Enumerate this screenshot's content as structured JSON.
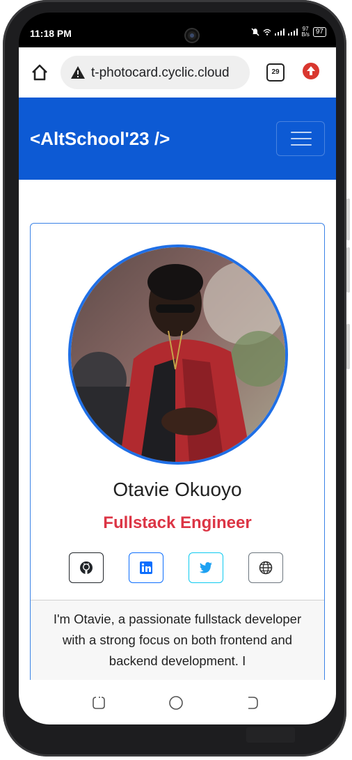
{
  "status": {
    "time": "11:18 PM",
    "net_speed_top": "97",
    "net_speed_bottom": "B/s",
    "battery": "97"
  },
  "browser": {
    "url": "t-photocard.cyclic.cloud",
    "tab_count": "29"
  },
  "navbar": {
    "brand": "<AltSchool'23 />"
  },
  "profile": {
    "name": "Otavie Okuoyo",
    "role": "Fullstack Engineer",
    "social": [
      {
        "label": "github",
        "color": "#212529"
      },
      {
        "label": "linkedin",
        "color": "#0d6efd"
      },
      {
        "label": "twitter",
        "color": "#0dcaf0"
      },
      {
        "label": "website",
        "color": "#6c757d"
      }
    ],
    "bio": "I'm Otavie, a passionate fullstack developer with a strong focus on both frontend and backend development. I"
  },
  "colors": {
    "primary": "#0d5ad4",
    "danger": "#dc3545"
  }
}
